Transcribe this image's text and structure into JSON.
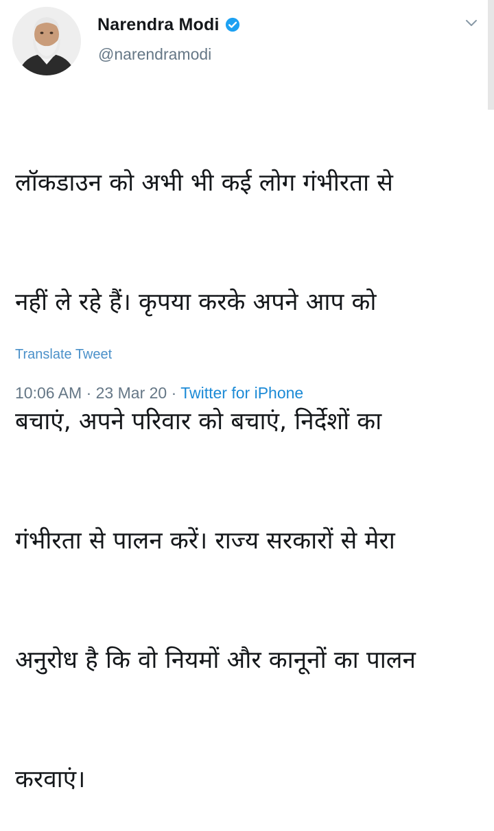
{
  "author": {
    "display_name": "Narendra Modi",
    "handle": "@narendramodi",
    "verified": true
  },
  "tweet": {
    "text_lines": [
      "लॉकडाउन को अभी भी कई लोग गंभीरता से",
      "नहीं ले रहे हैं। कृपया करके अपने आप को",
      "बचाएं, अपने परिवार को बचाएं, निर्देशों का",
      "गंभीरता से पालन करें। राज्य सरकारों से मेरा",
      "अनुरोध है कि वो नियमों और कानूनों का पालन",
      "करवाएं।"
    ],
    "translate_label": "Translate Tweet",
    "time": "10:06 AM",
    "separator": " · ",
    "date": "23 Mar 20",
    "source": "Twitter for iPhone"
  },
  "icons": {
    "verified": "verified-badge-icon",
    "menu": "chevron-down-icon"
  },
  "colors": {
    "verified_blue": "#1da1f2",
    "link_blue": "#1b8ad6",
    "muted_gray": "#657786"
  }
}
